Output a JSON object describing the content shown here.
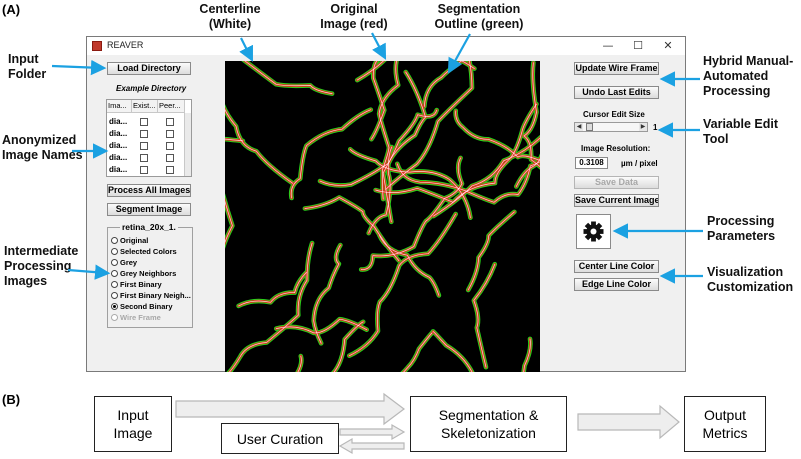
{
  "panels": {
    "a": "(A)",
    "b": "(B)"
  },
  "callouts": {
    "input_folder": [
      "Input",
      "Folder"
    ],
    "anonymized": [
      "Anonymized",
      "Image Names"
    ],
    "intermediate": [
      "Intermediate",
      "Processing",
      "Images"
    ],
    "centerline": [
      "Centerline",
      "(White)"
    ],
    "original": [
      "Original",
      "Image (red)"
    ],
    "segmentation": [
      "Segmentation",
      "Outline (green)"
    ],
    "hybrid": [
      "Hybrid Manual-",
      "Automated",
      "Processing"
    ],
    "variable": [
      "Variable Edit",
      "Tool"
    ],
    "processing_params": [
      "Processing",
      "Parameters"
    ],
    "visualization": [
      "Visualization",
      "Customization"
    ]
  },
  "window": {
    "title": "REAVER",
    "controls": [
      "—",
      "☐",
      "✕"
    ],
    "load_directory": "Load Directory",
    "example_directory": "Example Directory",
    "table": {
      "headers": [
        "Ima...",
        "Exist...",
        "Peer..."
      ],
      "rows": [
        "dia...",
        "dia...",
        "dia...",
        "dia...",
        "dia..."
      ]
    },
    "process_all": "Process All Images",
    "segment_image": "Segment Image",
    "image_group": {
      "title": "retina_20x_1.",
      "options": [
        "Original",
        "Selected Colors",
        "Grey",
        "Grey Neighbors",
        "First Binary",
        "First Binary Neigh...",
        "Second Binary",
        "Wire Frame"
      ],
      "selected": "Second Binary",
      "disabled": [
        "Wire Frame"
      ]
    },
    "update_wire_frame": "Update Wire Frame",
    "undo_last_edits": "Undo Last Edits",
    "cursor_edit_size": "Cursor Edit Size",
    "cursor_value": "1",
    "slider_level": 0.05,
    "image_resolution_label": "Image Resolution:",
    "resolution_value": "0.3108",
    "resolution_unit": "µm / pixel",
    "save_data": "Save Data",
    "save_current_image": "Save Current Image",
    "settings_icon": "gear-icon",
    "center_line_color": "Center Line Color",
    "edge_line_color": "Edge Line Color"
  },
  "flow": {
    "input_image": [
      "Input",
      "Image"
    ],
    "user_curation": "User Curation",
    "segmentation": [
      "Segmentation &",
      "Skeletonization"
    ],
    "output_metrics": [
      "Output",
      "Metrics"
    ]
  },
  "colors": {
    "arrow": "#1ba1e2",
    "vessel_edge": "#27d21b",
    "vessel_core": "#e8261a",
    "centerline": "#ffffff",
    "flow_arrow_fill": "#eeeeee",
    "flow_arrow_stroke": "#b8b8b8"
  }
}
